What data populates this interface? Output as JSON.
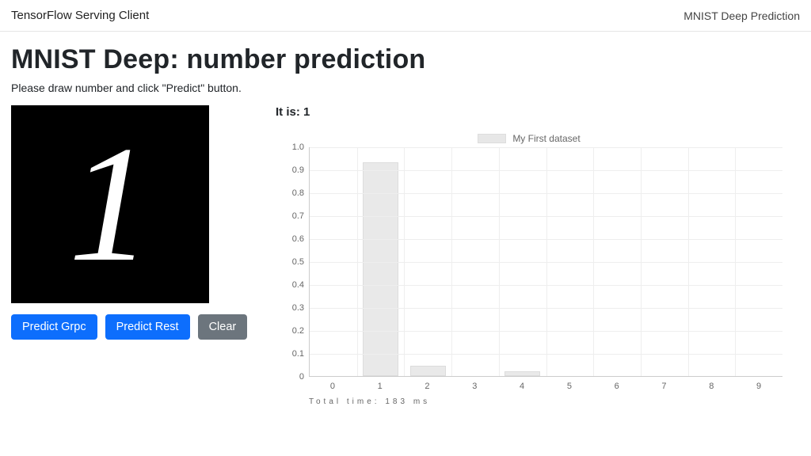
{
  "navbar": {
    "brand": "TensorFlow Serving Client",
    "right_link": "MNIST Deep Prediction"
  },
  "page": {
    "title": "MNIST Deep: number prediction",
    "lead": "Please draw number and click \"Predict\" button.",
    "drawn_digit": "1"
  },
  "buttons": {
    "predict_grpc": "Predict Grpc",
    "predict_rest": "Predict Rest",
    "clear": "Clear"
  },
  "result": {
    "label_prefix": "It is:",
    "value": "1"
  },
  "footnote": "Total time: 183 ms",
  "chart_data": {
    "type": "bar",
    "legend": "My First dataset",
    "categories": [
      "0",
      "1",
      "2",
      "3",
      "4",
      "5",
      "6",
      "7",
      "8",
      "9"
    ],
    "values": [
      0.0,
      0.93,
      0.045,
      0.0,
      0.02,
      0.0,
      0.0,
      0.0,
      0.0,
      0.0
    ],
    "y_ticks": [
      0,
      0.1,
      0.2,
      0.3,
      0.4,
      0.5,
      0.6,
      0.7,
      0.8,
      0.9,
      1.0
    ],
    "ylim": [
      0,
      1.0
    ],
    "xlabel": "",
    "ylabel": "",
    "title": ""
  }
}
